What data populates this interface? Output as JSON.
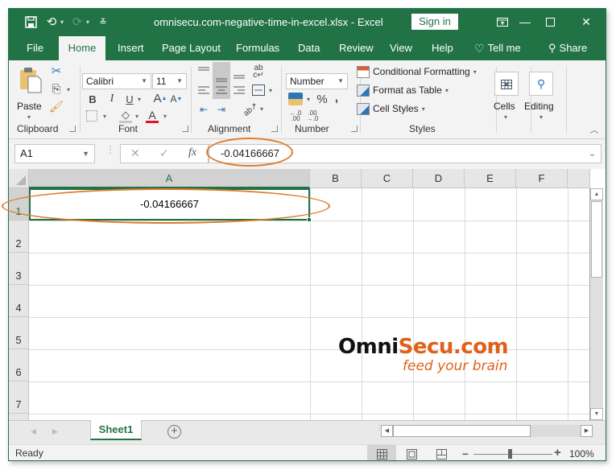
{
  "window": {
    "title": "omnisecu.com-negative-time-in-excel.xlsx  -  Excel",
    "sign_in_label": "Sign in",
    "qat": {
      "save_icon": "save-icon",
      "undo_icon": "undo-icon",
      "redo_icon": "redo-icon",
      "customize_icon": "customize-qat-icon"
    },
    "controls": {
      "ribbon_display": "ribbon-display-options-icon",
      "minimize": "minimize-icon",
      "maximize": "maximize-icon",
      "close": "close-icon"
    }
  },
  "tabs": [
    {
      "label": "File",
      "active": false
    },
    {
      "label": "Home",
      "active": true
    },
    {
      "label": "Insert",
      "active": false
    },
    {
      "label": "Page Layout",
      "active": false
    },
    {
      "label": "Formulas",
      "active": false
    },
    {
      "label": "Data",
      "active": false
    },
    {
      "label": "Review",
      "active": false
    },
    {
      "label": "View",
      "active": false
    },
    {
      "label": "Help",
      "active": false
    }
  ],
  "tell_me_label": "Tell me",
  "share_label": "Share",
  "ribbon": {
    "clipboard": {
      "label": "Clipboard",
      "paste_label": "Paste"
    },
    "font": {
      "label": "Font",
      "font_name": "Calibri",
      "font_size": "11",
      "bold": "B",
      "italic": "I",
      "underline": "U",
      "font_color": "#e81123"
    },
    "alignment": {
      "label": "Alignment"
    },
    "number": {
      "label": "Number",
      "format": "Number",
      "percent": "%",
      "comma": ","
    },
    "styles": {
      "label": "Styles",
      "conditional_formatting": "Conditional Formatting",
      "format_as_table": "Format as Table",
      "cell_styles": "Cell Styles"
    },
    "cells": {
      "label": "Cells"
    },
    "editing": {
      "label": "Editing"
    }
  },
  "formula_bar": {
    "name_box": "A1",
    "cancel": "✕",
    "enter": "✓",
    "fx": "fx",
    "value": "-0.04166667"
  },
  "grid": {
    "columns": [
      "A",
      "B",
      "C",
      "D",
      "E",
      "F"
    ],
    "rows": [
      "1",
      "2",
      "3",
      "4",
      "5",
      "6",
      "7"
    ],
    "selected_cell": "A1",
    "cells": {
      "A1": "-0.04166667"
    }
  },
  "watermark": {
    "omni": "Omni",
    "secu": "Secu.com",
    "tagline": "feed your brain"
  },
  "sheets": [
    {
      "name": "Sheet1",
      "active": true
    }
  ],
  "status": {
    "text": "Ready",
    "zoom": "100%",
    "zoom_level_percent": 100
  },
  "colors": {
    "accent": "#217346",
    "annotation": "#e07b2a",
    "brand_orange": "#e0601a"
  }
}
